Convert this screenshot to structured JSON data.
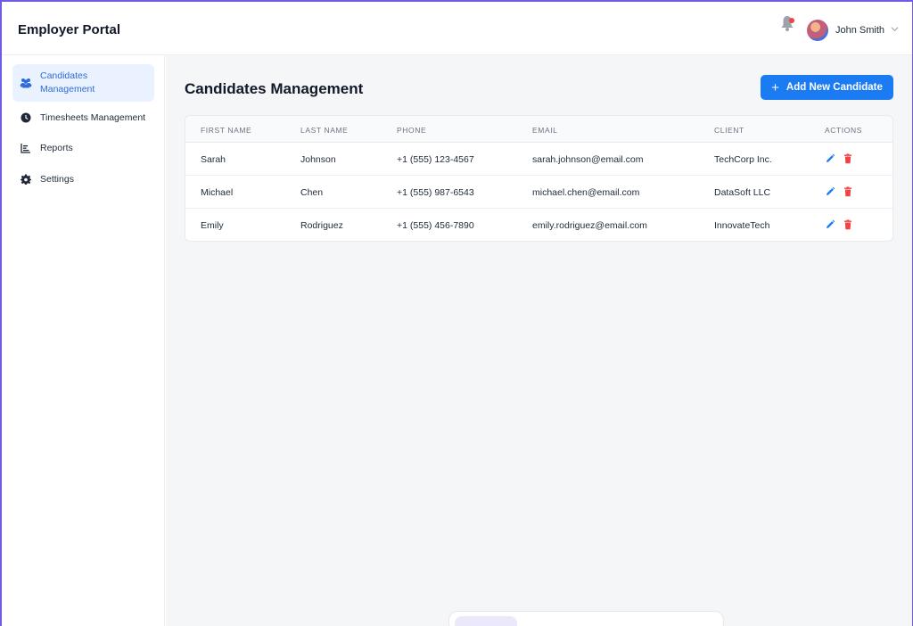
{
  "app": {
    "title": "Employer Portal"
  },
  "header": {
    "user_name": "John Smith",
    "notifications_unread": true
  },
  "sidebar": {
    "items": [
      {
        "label": "Candidates Management",
        "icon": "users-icon",
        "active": true
      },
      {
        "label": "Timesheets Management",
        "icon": "clock-icon",
        "active": false
      },
      {
        "label": "Reports",
        "icon": "chart-icon",
        "active": false
      },
      {
        "label": "Settings",
        "icon": "gear-icon",
        "active": false
      }
    ]
  },
  "main": {
    "title": "Candidates Management",
    "add_button_label": "Add New Candidate",
    "columns": [
      "FIRST NAME",
      "LAST NAME",
      "PHONE",
      "EMAIL",
      "CLIENT",
      "ACTIONS"
    ],
    "rows": [
      {
        "first": "Sarah",
        "last": "Johnson",
        "phone": "+1 (555) 123-4567",
        "email": "sarah.johnson@email.com",
        "client": "TechCorp Inc."
      },
      {
        "first": "Michael",
        "last": "Chen",
        "phone": "+1 (555) 987-6543",
        "email": "michael.chen@email.com",
        "client": "DataSoft LLC"
      },
      {
        "first": "Emily",
        "last": "Rodriguez",
        "phone": "+1 (555) 456-7890",
        "email": "emily.rodriguez@email.com",
        "client": "InnovateTech"
      }
    ]
  },
  "colors": {
    "accent": "#1a7bf2",
    "active_bg": "#eaf2ff",
    "delete": "#ef4444",
    "frame": "#6d5ce8"
  }
}
